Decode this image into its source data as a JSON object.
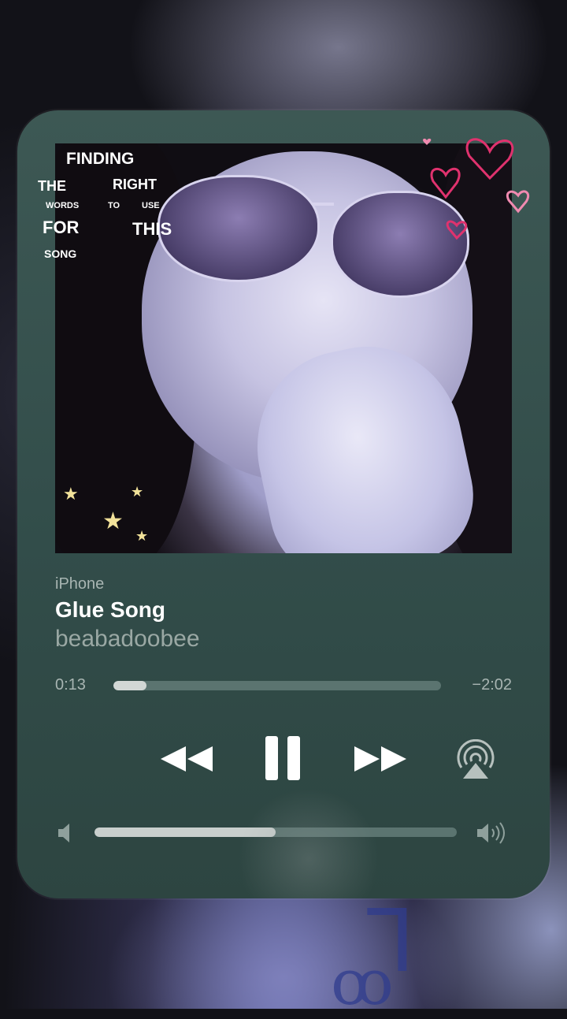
{
  "overlay": {
    "caption_words": [
      "FINDING",
      "THE",
      "RIGHT",
      "WORDS",
      "TO",
      "USE",
      "FOR",
      "THIS",
      "SONG"
    ]
  },
  "player": {
    "source": "iPhone",
    "title": "Glue Song",
    "artist": "beabadoobee",
    "elapsed": "0:13",
    "remaining": "−2:02",
    "progress_fraction": 0.1,
    "volume_fraction": 0.5
  },
  "controls": {
    "rewind_icon": "rewind-icon",
    "pause_icon": "pause-icon",
    "forward_icon": "fast-forward-icon",
    "airplay_icon": "airplay-icon",
    "volume_low_icon": "speaker-low-icon",
    "volume_high_icon": "speaker-high-icon"
  },
  "colors": {
    "widget_bg": "#3d5854",
    "accent_text": "#ffffff",
    "secondary_text": "#a8b5b2",
    "heart_stroke": "#e0326e"
  }
}
